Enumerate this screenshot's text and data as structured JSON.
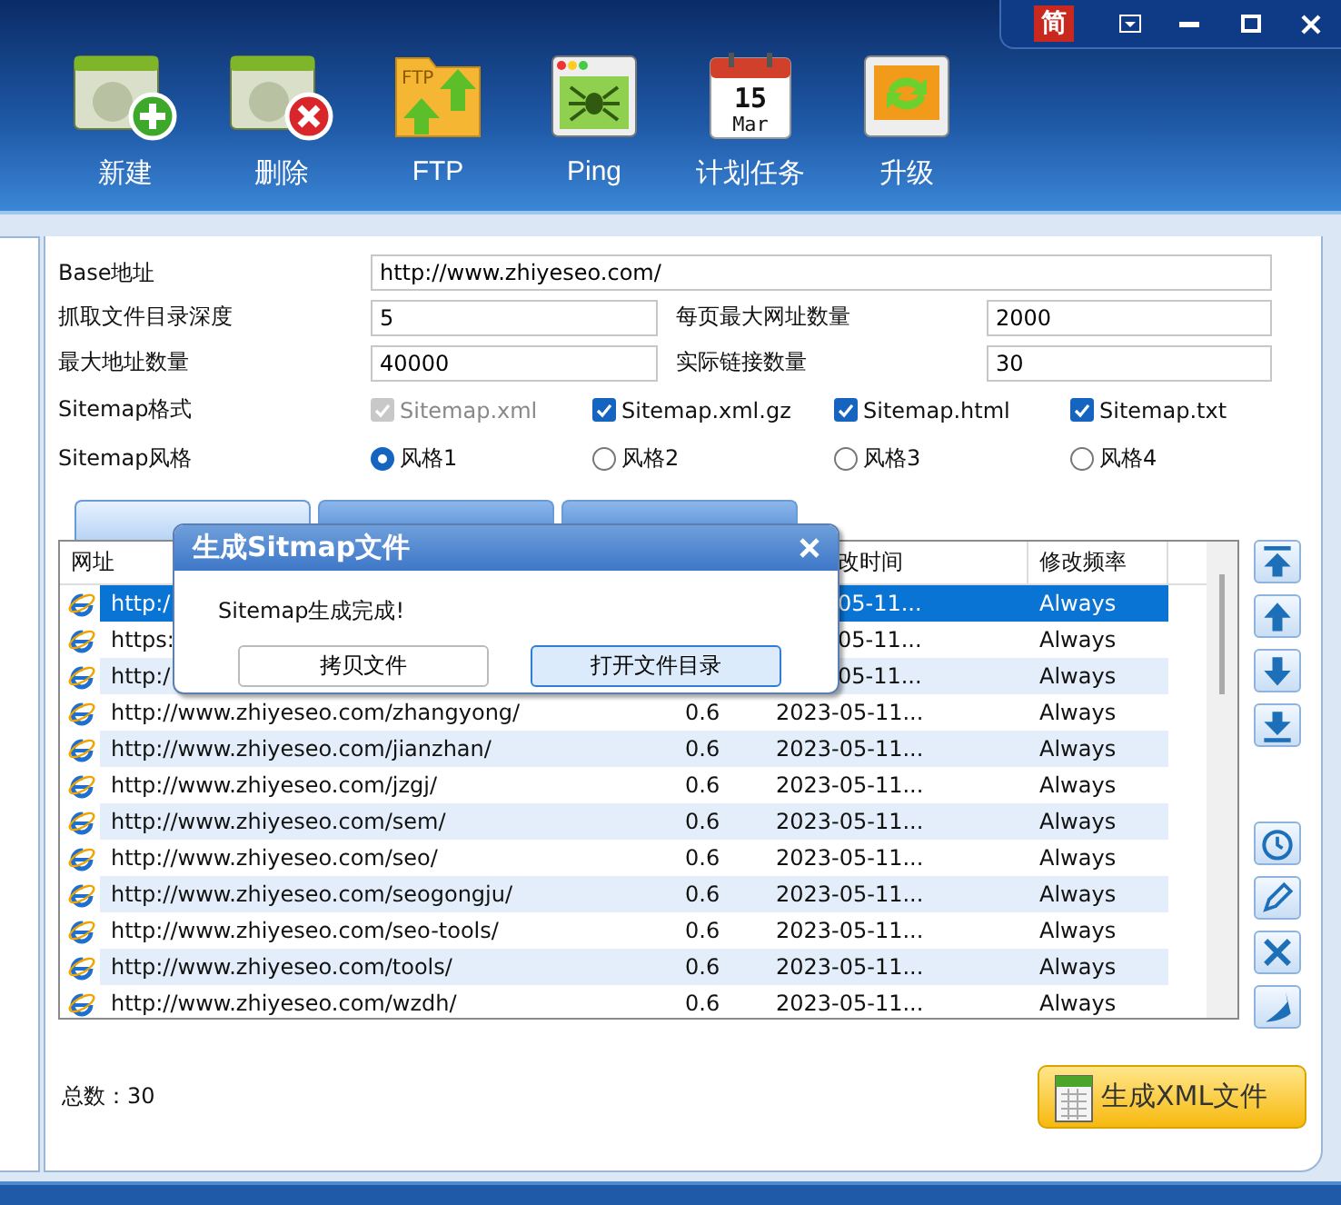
{
  "window_controls": {
    "language": "简"
  },
  "toolbar": [
    {
      "kind": "new",
      "label": "新建"
    },
    {
      "kind": "delete",
      "label": "删除"
    },
    {
      "kind": "ftp",
      "label": "FTP",
      "icon_text": "FTP"
    },
    {
      "kind": "ping",
      "label": "Ping"
    },
    {
      "kind": "schedule",
      "label": "计划任务",
      "icon_day": "15",
      "icon_month": "Mar"
    },
    {
      "kind": "upgrade",
      "label": "升级"
    }
  ],
  "form": {
    "base": {
      "label": "Base地址",
      "value": "http://www.zhiyeseo.com/"
    },
    "field_pairs": [
      [
        {
          "label": "抓取文件目录深度",
          "value": "5"
        },
        {
          "label": "每页最大网址数量",
          "value": "2000"
        }
      ],
      [
        {
          "label": "最大地址数量",
          "value": "40000"
        },
        {
          "label": "实际链接数量",
          "value": "30"
        }
      ]
    ],
    "formats": {
      "label": "Sitemap格式",
      "options": [
        {
          "label": "Sitemap.xml",
          "checked": true,
          "disabled": true
        },
        {
          "label": "Sitemap.xml.gz",
          "checked": true,
          "disabled": false
        },
        {
          "label": "Sitemap.html",
          "checked": true,
          "disabled": false
        },
        {
          "label": "Sitemap.txt",
          "checked": true,
          "disabled": false
        }
      ]
    },
    "styles": {
      "label": "Sitemap风格",
      "options": [
        {
          "label": "风格1",
          "selected": true
        },
        {
          "label": "风格2",
          "selected": false
        },
        {
          "label": "风格3",
          "selected": false
        },
        {
          "label": "风格4",
          "selected": false
        }
      ]
    }
  },
  "tabs": [
    {
      "selected": true
    },
    {
      "selected": false
    },
    {
      "selected": false
    }
  ],
  "table": {
    "columns": [
      {
        "label": "网址"
      },
      {},
      {
        "label": "改时间",
        "clipped": true
      },
      {
        "label": "修改频率"
      }
    ],
    "rows": [
      {
        "url": "http:/",
        "time": "05-11...",
        "freq": "Always",
        "selected": true,
        "clipped": true
      },
      {
        "url": "https:",
        "time": "05-11...",
        "freq": "Always",
        "selected": false,
        "clipped": true
      },
      {
        "url": "http:/",
        "time": "05-11...",
        "freq": "Always",
        "selected": false,
        "clipped": true
      },
      {
        "url": "http://www.zhiyeseo.com/zhangyong/",
        "priority": "0.6",
        "time": "2023-05-11...",
        "freq": "Always",
        "selected": false,
        "clipped": false
      },
      {
        "url": "http://www.zhiyeseo.com/jianzhan/",
        "priority": "0.6",
        "time": "2023-05-11...",
        "freq": "Always",
        "selected": false,
        "clipped": false
      },
      {
        "url": "http://www.zhiyeseo.com/jzgj/",
        "priority": "0.6",
        "time": "2023-05-11...",
        "freq": "Always",
        "selected": false,
        "clipped": false
      },
      {
        "url": "http://www.zhiyeseo.com/sem/",
        "priority": "0.6",
        "time": "2023-05-11...",
        "freq": "Always",
        "selected": false,
        "clipped": false
      },
      {
        "url": "http://www.zhiyeseo.com/seo/",
        "priority": "0.6",
        "time": "2023-05-11...",
        "freq": "Always",
        "selected": false,
        "clipped": false
      },
      {
        "url": "http://www.zhiyeseo.com/seogongju/",
        "priority": "0.6",
        "time": "2023-05-11...",
        "freq": "Always",
        "selected": false,
        "clipped": false
      },
      {
        "url": "http://www.zhiyeseo.com/seo-tools/",
        "priority": "0.6",
        "time": "2023-05-11...",
        "freq": "Always",
        "selected": false,
        "clipped": false
      },
      {
        "url": "http://www.zhiyeseo.com/tools/",
        "priority": "0.6",
        "time": "2023-05-11...",
        "freq": "Always",
        "selected": false,
        "clipped": false
      },
      {
        "url": "http://www.zhiyeseo.com/wzdh/",
        "priority": "0.6",
        "time": "2023-05-11...",
        "freq": "Always",
        "selected": false,
        "clipped": false
      }
    ]
  },
  "total": "总数：30",
  "generate_button": "生成XML文件",
  "dialog": {
    "title": "生成Sitmap文件",
    "message": "Sitemap生成完成!",
    "buttons": [
      {
        "label": "拷贝文件",
        "focused": false
      },
      {
        "label": "打开文件目录",
        "focused": true
      }
    ]
  }
}
